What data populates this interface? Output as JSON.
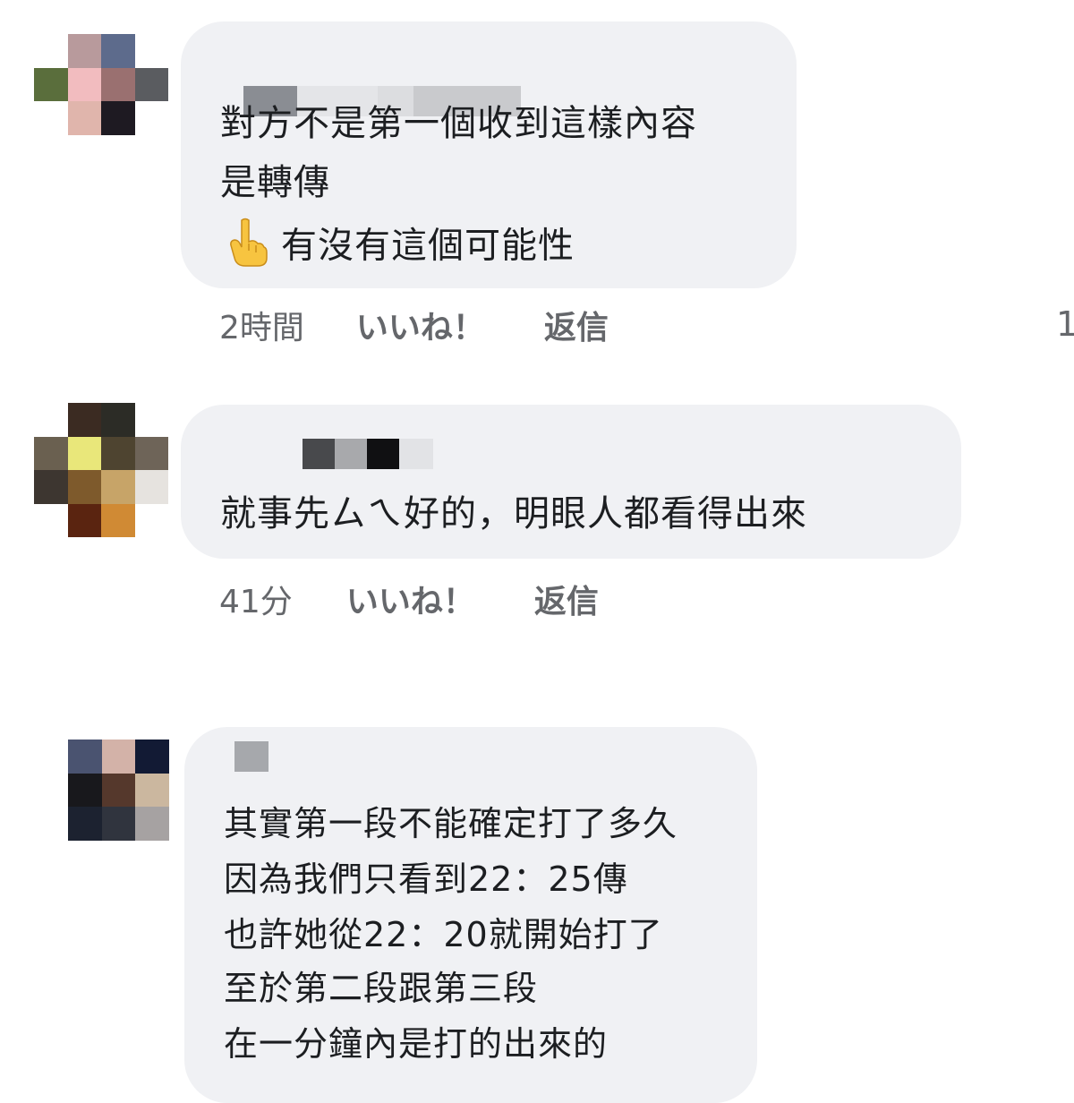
{
  "comments": [
    {
      "lines": [
        "對方不是第一個收到這樣內容",
        "是轉傳"
      ],
      "emoji_line": "有沒有這個可能性",
      "emoji_icon": "pointing-up-hand-icon",
      "time": "2時間",
      "like_label": "いいね！",
      "reply_label": "返信",
      "reaction_count": "1"
    },
    {
      "lines": [
        "就事先ㄙㄟ好的，明眼人都看得出來"
      ],
      "time": "41分",
      "like_label": "いいね！",
      "reply_label": "返信"
    },
    {
      "lines": [
        "其實第一段不能確定打了多久",
        "因為我們只看到22：25傳",
        "也許她從22：20就開始打了",
        "至於第二段跟第三段",
        "在一分鐘內是打的出來的"
      ]
    }
  ],
  "colors": {
    "bubble": "#f0f1f4",
    "meta_text": "#65676b",
    "body_text": "#1c1e21"
  }
}
